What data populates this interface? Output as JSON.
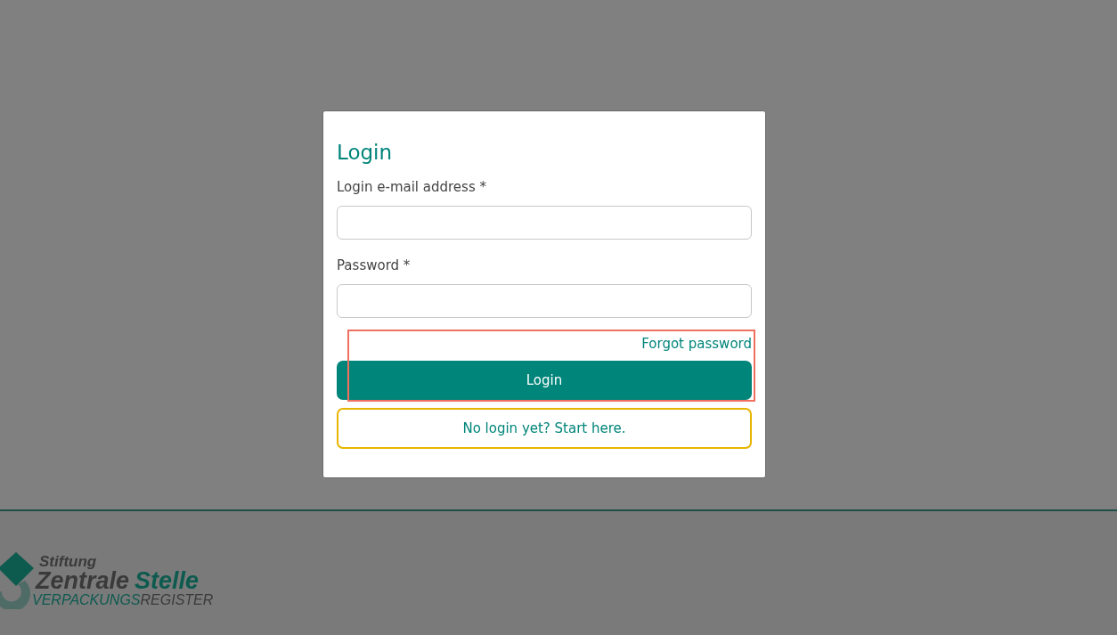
{
  "login_card": {
    "title": "Login",
    "fields": [
      {
        "label": "Login e-mail address *"
      },
      {
        "label": "Password *"
      }
    ],
    "forgot_link": "Forgot password",
    "login_button": "Login",
    "register_button": "No login yet? Start here."
  },
  "footer": {
    "logo": {
      "line1": "Stiftung",
      "line2": [
        "Zentrale",
        "Stelle"
      ],
      "line3": [
        "VERPACKUNGS",
        "REGISTER"
      ]
    }
  }
}
